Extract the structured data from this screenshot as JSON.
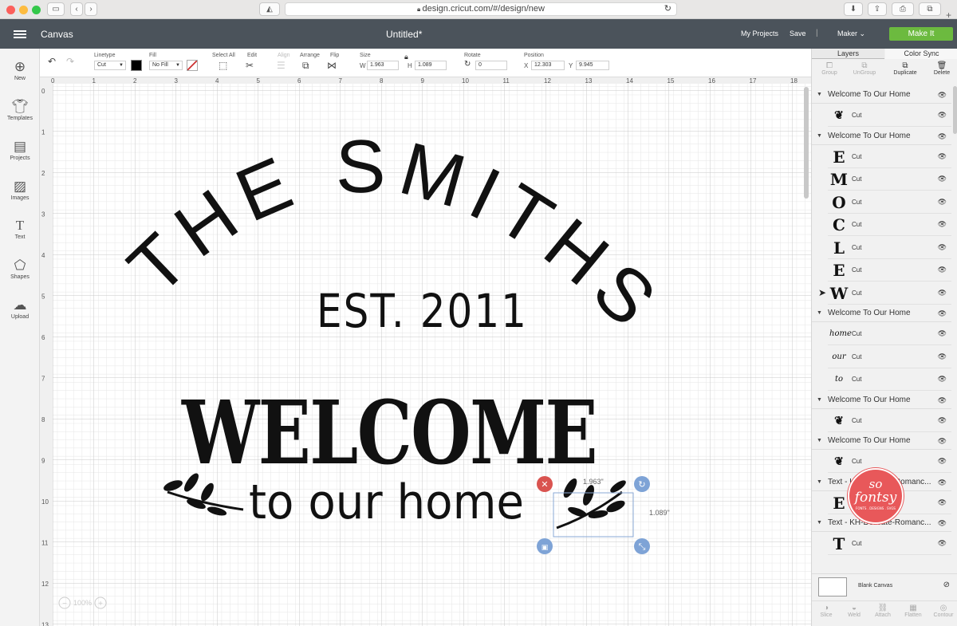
{
  "browser": {
    "url": "design.cricut.com/#/design/new",
    "traffic_colors": [
      "#fc605c",
      "#fdbc40",
      "#34c84a"
    ]
  },
  "topbar": {
    "menu_label": "Canvas",
    "doc_title": "Untitled*",
    "my_projects": "My Projects",
    "save": "Save",
    "separator": "|",
    "machine": "Maker",
    "make_it": "Make It",
    "bg_color": "#4b535b",
    "make_it_color": "#6cba3f"
  },
  "toolbar": {
    "linetype_label": "Linetype",
    "linetype_value": "Cut",
    "fill_label": "Fill",
    "fill_value": "No Fill",
    "select_all": "Select All",
    "edit": "Edit",
    "align": "Align",
    "arrange": "Arrange",
    "flip": "Flip",
    "size_label": "Size",
    "w_label": "W",
    "w_value": "1.963",
    "h_label": "H",
    "h_value": "1.089",
    "rotate_label": "Rotate",
    "rotate_value": "0",
    "position_label": "Position",
    "x_label": "X",
    "x_value": "12.303",
    "y_label": "Y",
    "y_value": "9.945"
  },
  "leftnav": [
    {
      "label": "New",
      "icon": "plus-circle-icon"
    },
    {
      "label": "Templates",
      "icon": "tshirt-icon"
    },
    {
      "label": "Projects",
      "icon": "projects-icon"
    },
    {
      "label": "Images",
      "icon": "image-icon"
    },
    {
      "label": "Text",
      "icon": "text-icon"
    },
    {
      "label": "Shapes",
      "icon": "shapes-icon"
    },
    {
      "label": "Upload",
      "icon": "upload-cloud-icon"
    }
  ],
  "ruler": {
    "top": [
      "0",
      "1",
      "2",
      "3",
      "4",
      "5",
      "6",
      "7",
      "8",
      "9",
      "10",
      "11",
      "12",
      "13",
      "14",
      "15",
      "16",
      "17",
      "18"
    ],
    "left": [
      "0",
      "1",
      "2",
      "3",
      "4",
      "5",
      "6",
      "7",
      "8",
      "9",
      "10",
      "11",
      "12",
      "13"
    ]
  },
  "design": {
    "arc_text": "THE SMITHS",
    "est": "EST. 2011",
    "welcome": "WELCOME",
    "to_our_home": "to our home"
  },
  "selection": {
    "width_label": "1.963\"",
    "height_label": "1.089\""
  },
  "zoom": {
    "level": "100%",
    "minus": "−",
    "plus": "+"
  },
  "panel": {
    "tab_layers": "Layers",
    "tab_color_sync": "Color Sync",
    "group": "Group",
    "ungroup": "UnGroup",
    "duplicate": "Duplicate",
    "delete": "Delete",
    "groups": [
      {
        "title": "Welcome To Our Home",
        "layers": [
          {
            "thumb": "❦",
            "op": "Cut"
          }
        ]
      },
      {
        "title": "Welcome To Our Home",
        "layers": [
          {
            "thumb": "E",
            "op": "Cut"
          },
          {
            "thumb": "M",
            "op": "Cut"
          },
          {
            "thumb": "O",
            "op": "Cut"
          },
          {
            "thumb": "C",
            "op": "Cut"
          },
          {
            "thumb": "L",
            "op": "Cut"
          },
          {
            "thumb": "E",
            "op": "Cut"
          },
          {
            "thumb": "W",
            "op": "Cut"
          }
        ]
      },
      {
        "title": "Welcome To Our Home",
        "layers": [
          {
            "thumb": "home",
            "op": "Cut"
          },
          {
            "thumb": "our",
            "op": "Cut"
          },
          {
            "thumb": "to",
            "op": "Cut"
          }
        ]
      },
      {
        "title": "Welcome To Our Home",
        "layers": [
          {
            "thumb": "❦",
            "op": "Cut"
          }
        ]
      },
      {
        "title": "Welcome To Our Home",
        "layers": [
          {
            "thumb": "❦",
            "op": "Cut"
          }
        ]
      },
      {
        "title": "Text - KH-Delicate-Romanc...",
        "layers": [
          {
            "thumb": "E",
            "op": "Cut"
          }
        ]
      },
      {
        "title": "Text - KH-Delicate-Romanc...",
        "layers": [
          {
            "thumb": "T",
            "op": "Cut"
          }
        ]
      }
    ],
    "blank_canvas": "Blank Canvas",
    "bottom_tools": [
      "Slice",
      "Weld",
      "Attach",
      "Flatten",
      "Contour"
    ]
  },
  "watermark": {
    "line1": "so",
    "line2": "fontsy",
    "line3": "FONTS . DESIGNS . SVGS",
    "color": "#e8585a"
  }
}
